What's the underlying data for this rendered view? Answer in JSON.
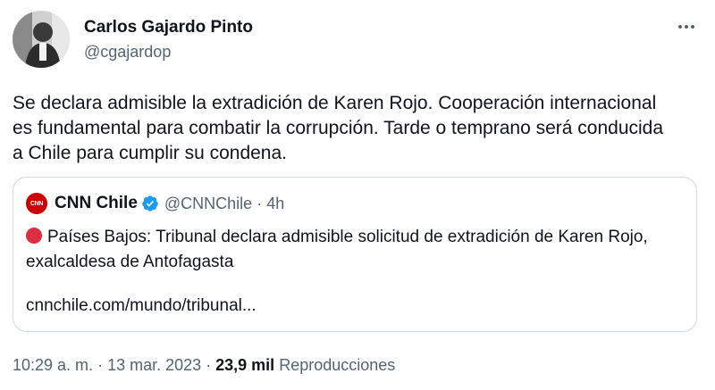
{
  "author": {
    "name": "Carlos Gajardo Pinto",
    "handle": "@cgajardop"
  },
  "tweet": {
    "text": "Se declara admisible la extradición de Karen Rojo. Cooperación internacional es fundamental para combatir la corrupción. Tarde o temprano será conducida a Chile para cumplir su condena."
  },
  "quote": {
    "name": "CNN Chile",
    "handle": "@CNNChile",
    "separator": "·",
    "time": "4h",
    "logo_text": "CNN CHILE",
    "text": "Países Bajos: Tribunal declara admisible solicitud de extradición de Karen Rojo, exalcaldesa de Antofagasta",
    "link": "cnnchile.com/mundo/tribunal..."
  },
  "meta": {
    "time": "10:29 a. m.",
    "sep1": " · ",
    "date": "13 mar. 2023",
    "sep2": " · ",
    "views_count": "23,9 mil",
    "views_label": " Reproducciones"
  },
  "colors": {
    "text": "#0f1419",
    "secondary": "#536471",
    "border": "#cfd9de",
    "verified": "#1d9bf0",
    "cnn_red": "#cc0000",
    "red_circle": "#dd2e44"
  },
  "icons": {
    "more": "more-horizontal-icon",
    "verified": "verified-badge-icon",
    "red_circle": "red-circle-emoji-icon"
  }
}
